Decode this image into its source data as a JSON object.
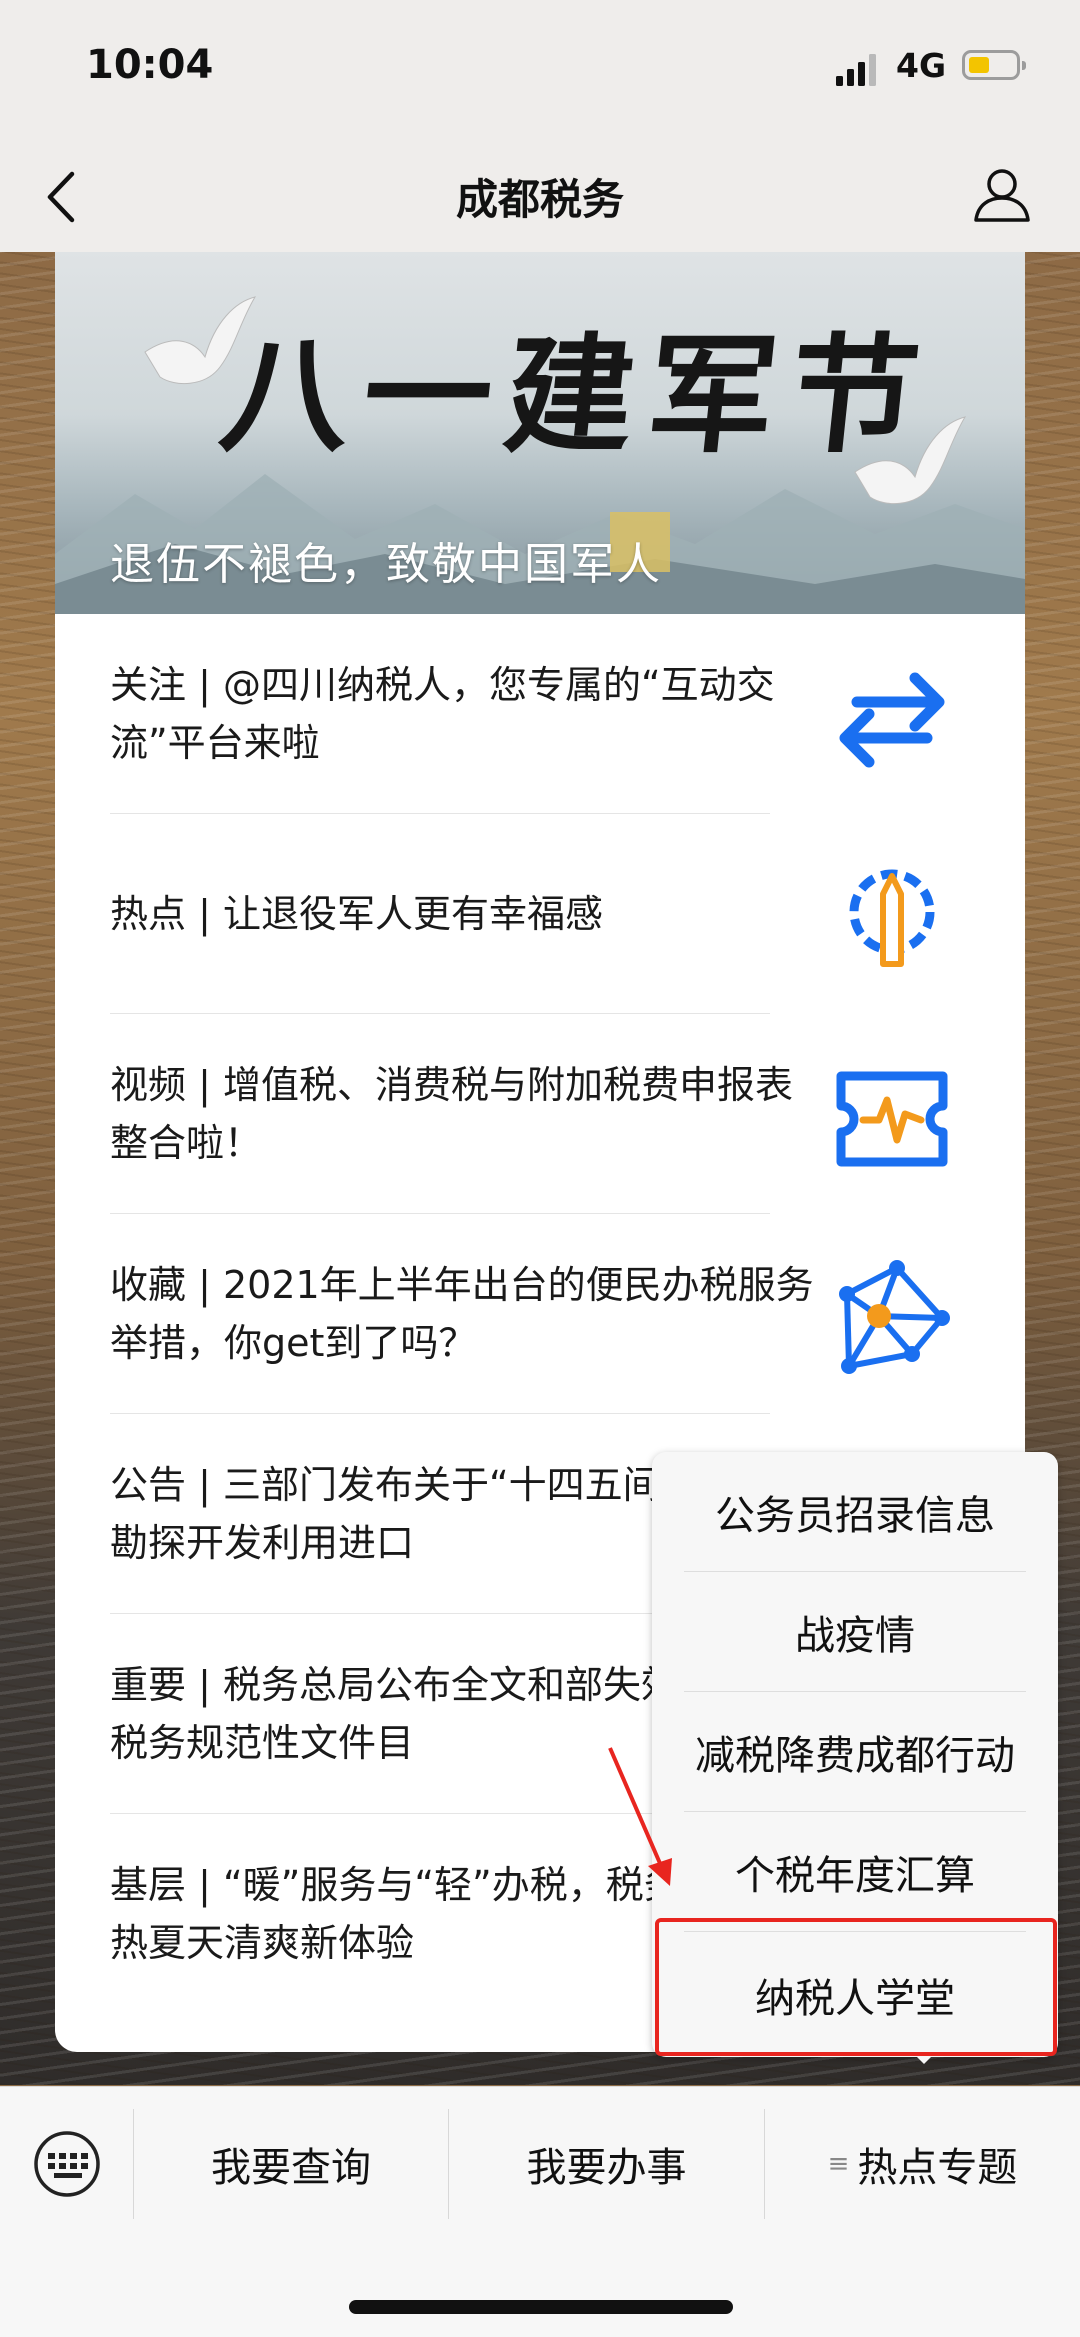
{
  "status": {
    "time": "10:04",
    "network": "4G"
  },
  "nav": {
    "title": "成都税务"
  },
  "banner": {
    "title": "八一建军节",
    "caption": "退伍不褪色，致敬中国军人"
  },
  "articles": [
    {
      "text": "关注 | @四川纳税人，您专属的“互动交流”平台来啦",
      "icon": "exchange-arrows-icon"
    },
    {
      "text": "热点 | 让退役军人更有幸福感",
      "icon": "gear-pencil-icon"
    },
    {
      "text": "视频 | 增值税、消费税与附加税费申报表整合啦！",
      "icon": "ticket-pulse-icon"
    },
    {
      "text": "收藏 | 2021年上半年出台的便民办税服务举措，你get到了吗？",
      "icon": "network-nodes-icon"
    },
    {
      "text": "公告 | 三部门发布关于“十四五间能源资源勘探开发利用进口",
      "icon": ""
    },
    {
      "text": "重要 | 税务总局公布全文和部失效废止的税务规范性文件目",
      "icon": ""
    },
    {
      "text": "基层 | “暖”服务与“轻”办税，税务带来炎热夏天清爽新体验",
      "icon": ""
    }
  ],
  "menu": {
    "items": [
      "公务员招录信息",
      "战疫情",
      "减税降费成都行动",
      "个税年度汇算",
      "纳税人学堂"
    ]
  },
  "tabbar": {
    "tabs": [
      "我要查询",
      "我要办事",
      "热点专题"
    ],
    "menu_marker": "≡"
  },
  "colors": {
    "accent_blue": "#1a6ff0",
    "accent_orange": "#f39a1c",
    "highlight_red": "#e8251f"
  }
}
